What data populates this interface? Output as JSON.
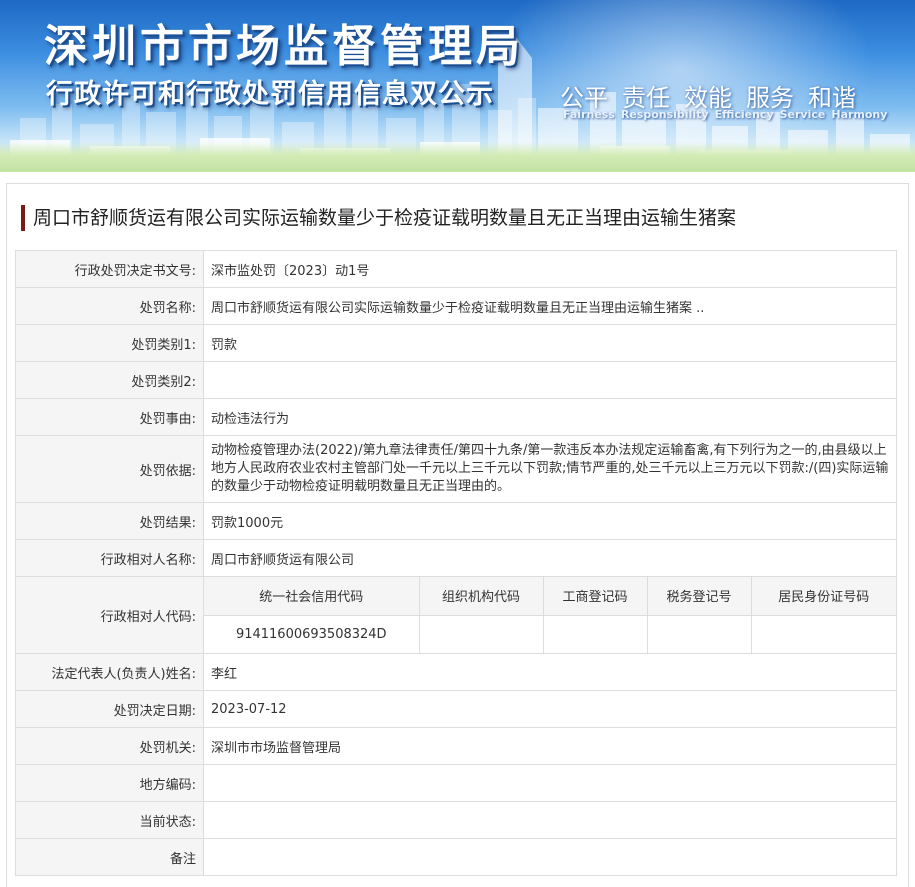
{
  "banner": {
    "title": "深圳市市场监督管理局",
    "subtitle": "行政许可和行政处罚信用信息双公示",
    "values_cn": [
      "公平",
      "责任",
      "效能",
      "服务",
      "和谐"
    ],
    "values_en": [
      "Fairness",
      "Responsibility",
      "Efficiency",
      "Service",
      "Harmony"
    ]
  },
  "case_title": "周口市舒顺货运有限公司实际运输数量少于检疫证载明数量且无正当理由运输生猪案",
  "rows": {
    "doc_no": {
      "label": "行政处罚决定书文号:",
      "value": "深市监处罚〔2023〕动1号"
    },
    "penalty_name": {
      "label": "处罚名称:",
      "value": "周口市舒顺货运有限公司实际运输数量少于检疫证载明数量且无正当理由运输生猪案 .."
    },
    "category1": {
      "label": "处罚类别1:",
      "value": "罚款"
    },
    "category2": {
      "label": "处罚类别2:",
      "value": ""
    },
    "cause": {
      "label": "处罚事由:",
      "value": "动检违法行为"
    },
    "basis": {
      "label": "处罚依据:",
      "value": "动物检疫管理办法(2022)/第九章法律责任/第四十九条/第一款违反本办法规定运输畜禽,有下列行为之一的,由县级以上地方人民政府农业农村主管部门处一千元以上三千元以下罚款;情节严重的,处三千元以上三万元以下罚款:/(四)实际运输的数量少于动物检疫证明载明数量且无正当理由的。"
    },
    "result": {
      "label": "处罚结果:",
      "value": "罚款1000元"
    },
    "party_name": {
      "label": "行政相对人名称:",
      "value": "周口市舒顺货运有限公司"
    },
    "party_code": {
      "label": "行政相对人代码:",
      "headers": [
        "统一社会信用代码",
        "组织机构代码",
        "工商登记码",
        "税务登记号",
        "居民身份证号码"
      ],
      "values": [
        "91411600693508324D",
        "",
        "",
        "",
        ""
      ]
    },
    "legal_rep": {
      "label": "法定代表人(负责人)姓名:",
      "value": "李红"
    },
    "decision_date": {
      "label": "处罚决定日期:",
      "value": "2023-07-12"
    },
    "authority": {
      "label": "处罚机关:",
      "value": "深圳市市场监督管理局"
    },
    "region_code": {
      "label": "地方编码:",
      "value": ""
    },
    "status": {
      "label": "当前状态:",
      "value": ""
    },
    "remark": {
      "label": "备注",
      "value": ""
    }
  }
}
